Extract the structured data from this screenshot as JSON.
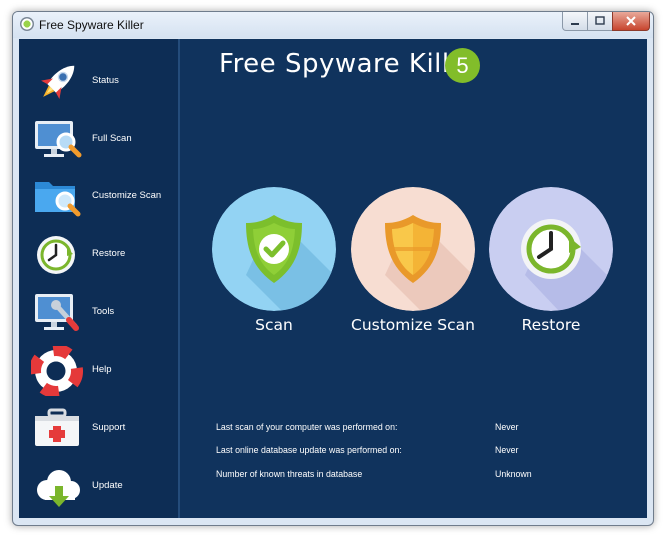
{
  "window": {
    "title": "Free Spyware Killer"
  },
  "sidebar": {
    "items": [
      {
        "label": "Status",
        "icon": "rocket-icon"
      },
      {
        "label": "Full Scan",
        "icon": "monitor-magnifier-icon"
      },
      {
        "label": "Customize Scan",
        "icon": "folder-magnifier-icon"
      },
      {
        "label": "Restore",
        "icon": "clock-restore-icon"
      },
      {
        "label": "Tools",
        "icon": "monitor-wrench-icon"
      },
      {
        "label": "Help",
        "icon": "lifebuoy-icon"
      },
      {
        "label": "Support",
        "icon": "first-aid-kit-icon"
      },
      {
        "label": "Update",
        "icon": "cloud-download-icon"
      }
    ]
  },
  "main": {
    "title": "Free Spyware Killer",
    "version": "5",
    "actions": [
      {
        "label": "Scan",
        "icon": "shield-check-icon"
      },
      {
        "label": "Customize Scan",
        "icon": "shield-icon"
      },
      {
        "label": "Restore",
        "icon": "clock-restore-icon"
      }
    ],
    "info": [
      {
        "label": "Last scan of your computer was performed on:",
        "value": "Never"
      },
      {
        "label": "Last online database update was performed on:",
        "value": "Never"
      },
      {
        "label": "Number of known threats in database",
        "value": "Unknown"
      }
    ]
  },
  "colors": {
    "sidebar_bg": "#0d2d55",
    "main_bg": "#10335d",
    "badge": "#82bd2a",
    "scan_circle": "#93d3f3",
    "customize_circle": "#f7ddd2",
    "restore_circle": "#c9cef1"
  }
}
